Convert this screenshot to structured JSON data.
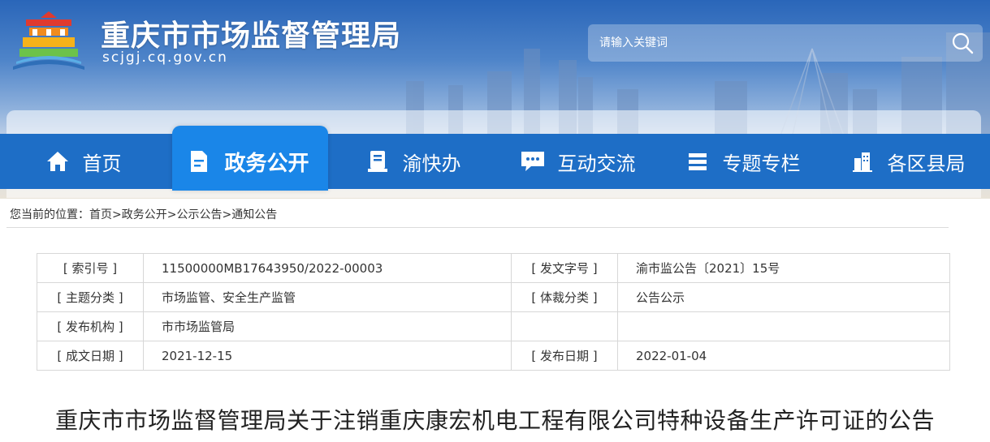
{
  "header": {
    "site_title": "重庆市市场监督管理局",
    "site_domain": "scjgj.cq.gov.cn",
    "search_placeholder": "请输入关键词",
    "search_icon": "search-icon"
  },
  "nav": {
    "items": [
      {
        "label": "首页",
        "icon": "home-icon"
      },
      {
        "label": "政务公开",
        "icon": "document-icon"
      },
      {
        "label": "渝快办",
        "icon": "service-icon"
      },
      {
        "label": "互动交流",
        "icon": "chat-icon"
      },
      {
        "label": "专题专栏",
        "icon": "list-icon"
      },
      {
        "label": "各区县局",
        "icon": "building-icon"
      }
    ],
    "active_index": 1
  },
  "breadcrumb": {
    "prefix": "您当前的位置：",
    "items": [
      "首页",
      "政务公开",
      "公示公告",
      "通知公告"
    ],
    "separator": ">"
  },
  "meta": {
    "index_no_label": "[ 索引号 ]",
    "index_no_value": "11500000MB17643950/2022-00003",
    "doc_no_label": "[ 发文字号 ]",
    "doc_no_value": "渝市监公告〔2021〕15号",
    "topic_label": "[ 主题分类 ]",
    "topic_value": "市场监管、安全生产监管",
    "genre_label": "[ 体裁分类 ]",
    "genre_value": "公告公示",
    "publisher_label": "[ 发布机构 ]",
    "publisher_value": "市市场监管局",
    "created_label": "[ 成文日期 ]",
    "created_value": "2021-12-15",
    "published_label": "[ 发布日期 ]",
    "published_value": "2022-01-04"
  },
  "article": {
    "title": "重庆市市场监督管理局关于注销重庆康宏机电工程有限公司特种设备生产许可证的公告"
  },
  "colors": {
    "nav_bg": "#1e6ec6",
    "nav_active": "#1a86e8",
    "header_text": "#ffffff"
  }
}
